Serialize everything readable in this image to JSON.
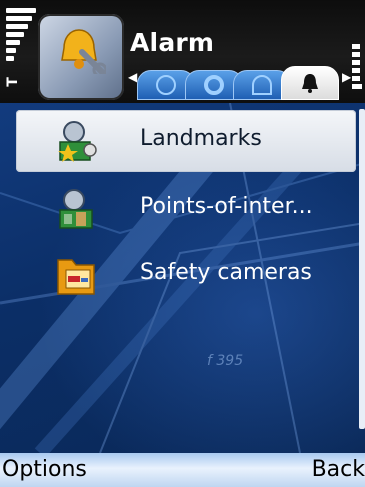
{
  "header": {
    "title": "Alarm",
    "app_icon": "alarm-bell-settings-icon",
    "tabs": [
      {
        "icon": "globe-icon",
        "active": false
      },
      {
        "icon": "target-icon",
        "active": false
      },
      {
        "icon": "gauge-icon",
        "active": false
      },
      {
        "icon": "alarm-bell-icon",
        "active": true
      }
    ]
  },
  "list": {
    "items": [
      {
        "label": "Landmarks",
        "icon": "landmarks-icon",
        "selected": true
      },
      {
        "label": "Points-of-inter...",
        "icon": "points-of-interest-icon",
        "selected": false
      },
      {
        "label": "Safety cameras",
        "icon": "safety-camera-folder-icon",
        "selected": false
      }
    ]
  },
  "background": {
    "map_text": "f 395"
  },
  "softkeys": {
    "left": "Options",
    "right": "Back"
  },
  "colors": {
    "accent": "#1f5fb3",
    "background": "#0a2c63",
    "selection": "#e6eaf0",
    "softkey_bar": "#d4e5f9"
  }
}
